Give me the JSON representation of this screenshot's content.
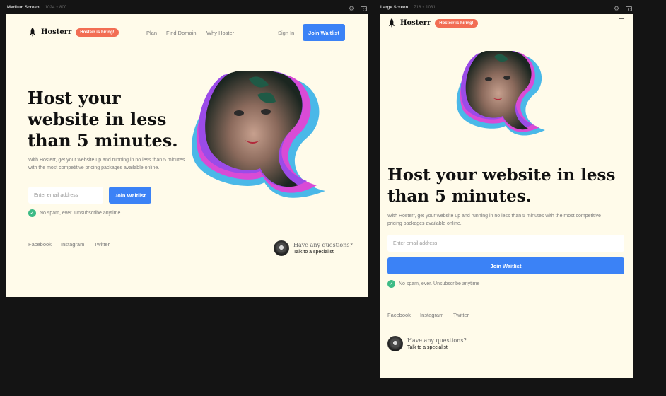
{
  "frames": {
    "medium": {
      "label": "Medium Screen",
      "size": "1024 x 800"
    },
    "large": {
      "label": "Large Screen",
      "size": "718 x 1031"
    }
  },
  "brand": {
    "name": "Hosterr",
    "badge": "Hosterr is hiring!"
  },
  "nav": {
    "plan": "Plan",
    "find_domain": "Find Domain",
    "why_hoster": "Why Hoster",
    "sign_in": "Sign In",
    "join": "Join Waitlist"
  },
  "hero": {
    "headline": "Host your website in less than 5 minutes.",
    "description": "With Hosterr, get your website up and running in no less than 5 minutes with the most competitive pricing packages available online.",
    "email_placeholder": "Enter email address",
    "cta": "Join Waitlist",
    "no_spam": "No spam, ever. Unsubscribe anytime"
  },
  "social": {
    "facebook": "Facebook",
    "instagram": "Instagram",
    "twitter": "Twitter"
  },
  "contact": {
    "question": "Have any questions?",
    "link": "Talk to a specialist"
  },
  "colors": {
    "accent": "#3b82f6",
    "badge": "#f26d53",
    "page_bg": "#fffbea",
    "check": "#3dbb86",
    "canvas_bg": "#141414"
  },
  "icons": {
    "logo": "rocket-icon",
    "settings": "gear-icon",
    "capture": "camera-icon",
    "menu": "menu-icon",
    "check": "check-circle-icon"
  }
}
